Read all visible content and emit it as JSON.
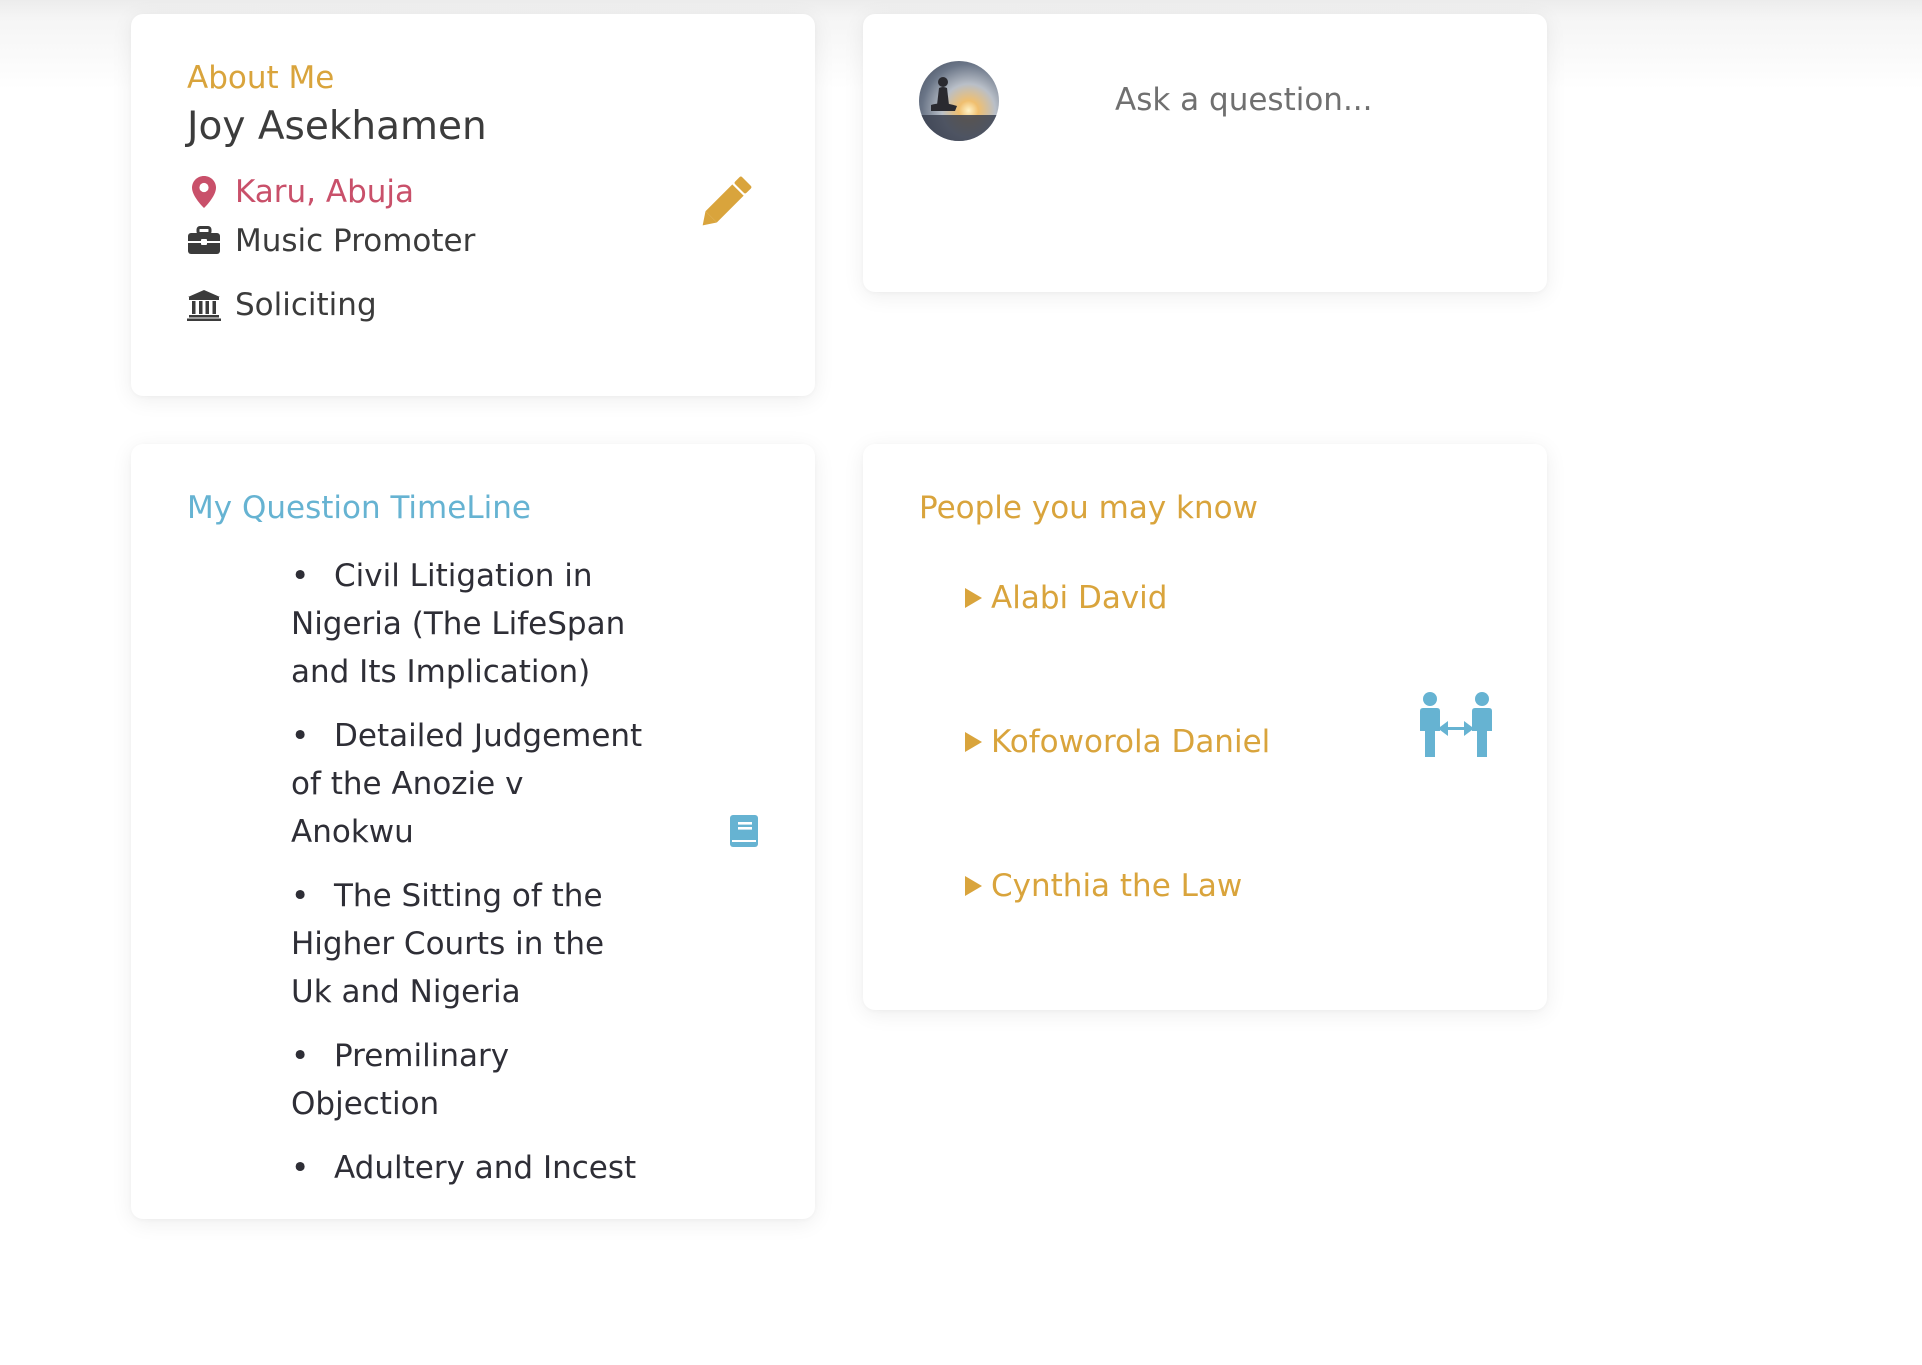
{
  "about": {
    "label": "About Me",
    "name": "Joy Asekhamen",
    "location": "Karu, Abuja",
    "occupation": "Music Promoter",
    "sector": "Soliciting",
    "icons": {
      "location": "map-marker-icon",
      "occupation": "briefcase-icon",
      "sector": "institution-icon",
      "edit": "pencil-icon"
    }
  },
  "ask": {
    "placeholder": "Ask a question..."
  },
  "timeline": {
    "heading": "My Question TimeLine",
    "items": [
      "Civil Litigation in Nigeria (The LifeSpan and Its Implication)",
      "Detailed Judgement of the Anozie v Anokwu",
      "The Sitting of the Higher Courts in the Uk and Nigeria",
      "Premilinary Objection",
      "Adultery and Incest"
    ],
    "icon": "book-icon"
  },
  "people": {
    "heading": "People you may know",
    "items": [
      "Alabi David",
      "Kofoworola Daniel",
      "Cynthia the Law"
    ],
    "icon": "connect-people-icon"
  },
  "colors": {
    "accent_gold": "#d9a43c",
    "accent_blue": "#66b3d2",
    "location_red": "#c9506a",
    "text_dark": "#3c3c3c"
  }
}
